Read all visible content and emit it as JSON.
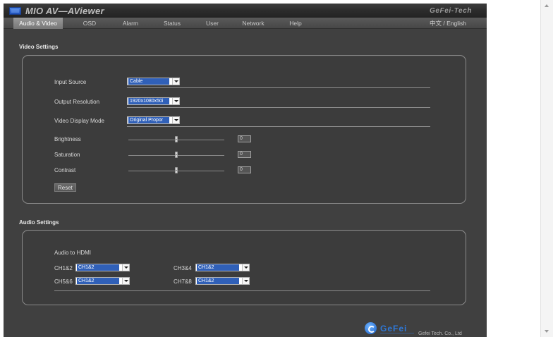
{
  "app": {
    "title": "MIO  AV—AViewer",
    "brand": "GeFei-Tech",
    "accent_color": "#3060b8"
  },
  "menu": {
    "items": [
      {
        "label": "Audio & Video",
        "active": true
      },
      {
        "label": "OSD"
      },
      {
        "label": "Alarm"
      },
      {
        "label": "Status"
      },
      {
        "label": "User"
      },
      {
        "label": "Network"
      },
      {
        "label": "Help"
      }
    ],
    "language": "中文 / English"
  },
  "video": {
    "section_title": "Video Settings",
    "input_source": {
      "label": "Input Source",
      "value": "Cable"
    },
    "output_resolution": {
      "label": "Output Resolution",
      "value": "1920x1080x50i"
    },
    "display_mode": {
      "label": "Video Display Mode",
      "value": "Original Propor"
    },
    "brightness": {
      "label": "Brightness",
      "value": "0"
    },
    "saturation": {
      "label": "Saturation",
      "value": "0"
    },
    "contrast": {
      "label": "Contrast",
      "value": "0"
    },
    "reset_label": "Reset"
  },
  "audio": {
    "section_title": "Audio Settings",
    "subtitle": "Audio to HDMI",
    "channels": [
      {
        "label": "CH1&2",
        "value": "CH1&2"
      },
      {
        "label": "CH3&4",
        "value": "CH1&2"
      },
      {
        "label": "CH5&6",
        "value": "CH1&2"
      },
      {
        "label": "CH7&8",
        "value": "CH1&2"
      }
    ]
  },
  "footer": {
    "brand": "GeFei",
    "company": "Gefei Tech. Co., Ltd"
  }
}
